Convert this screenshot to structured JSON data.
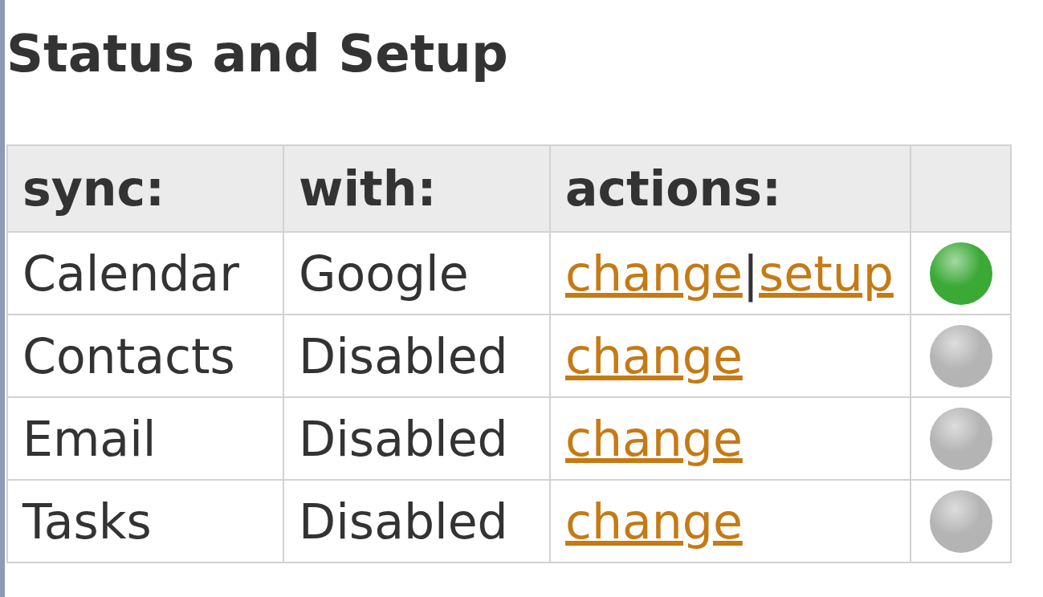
{
  "title": "Status and Setup",
  "table": {
    "columns": [
      "sync:",
      "with:",
      "actions:"
    ],
    "rows": [
      {
        "sync": "Calendar",
        "with": "Google",
        "actions": [
          "change",
          "setup"
        ],
        "separator": "|",
        "color": "#3aa935"
      },
      {
        "sync": "Contacts",
        "with": "Disabled",
        "actions": [
          "change"
        ],
        "color": "#b4b4b4"
      },
      {
        "sync": "Email",
        "with": "Disabled",
        "actions": [
          "change"
        ],
        "color": "#b4b4b4"
      },
      {
        "sync": "Tasks",
        "with": "Disabled",
        "actions": [
          "change"
        ],
        "color": "#b4b4b4"
      }
    ]
  }
}
